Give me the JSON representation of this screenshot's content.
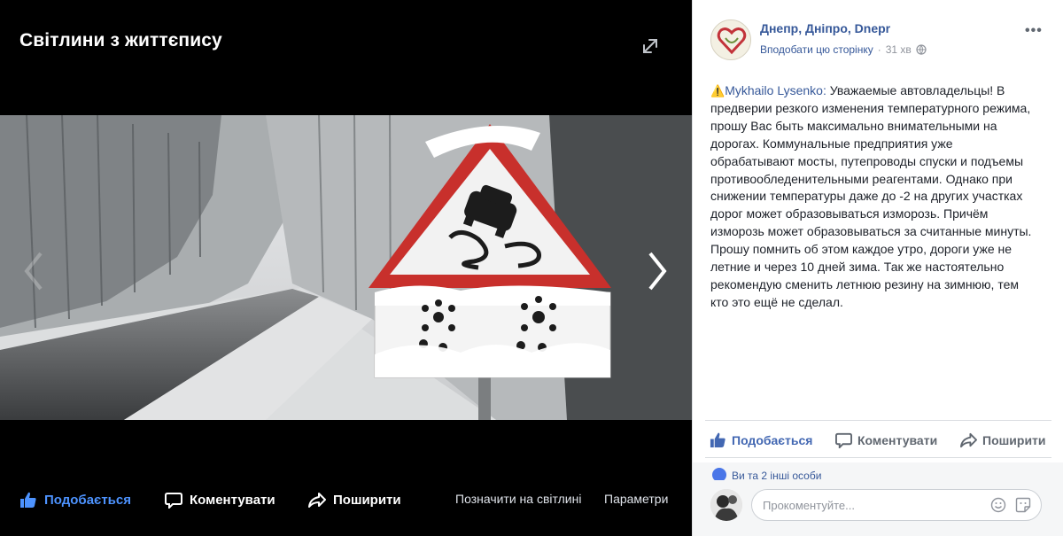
{
  "viewer": {
    "title": "Світлини з життєпису",
    "actions": {
      "like": "Подобається",
      "comment": "Коментувати",
      "share": "Поширити",
      "tag": "Позначити на світлині",
      "options": "Параметри"
    },
    "accent_color": "#4d93ff"
  },
  "post": {
    "page_name": "Днепр, Дніпро, Dnepr",
    "like_page": "Вподобати цю сторінку",
    "separator": "·",
    "time": "31 хв",
    "menu": "•••",
    "author": "Mykhailo Lysenko:",
    "body": " Уважаемые автовладельцы! В предверии резкого изменения температурного режима, прошу Вас быть максимально внимательными на дорогах. Коммунальные предприятия уже обрабатывают мосты, путепроводы спуски и подъемы противообледенительными реагентами. Однако при снижении температуры даже до -2 на других участках дорог может образовываться изморозь. Причём изморозь может образовываться за считанные минуты. Прошу помнить об этом каждое утро, дороги уже не летние и через 10 дней зима. Так же настоятельно рекомендую сменить летнюю резину на зимнюю, тем кто это ещё не сделал.",
    "warning_icon": "⚠️",
    "actions": {
      "like": "Подобається",
      "comment": "Коментувати",
      "share": "Поширити"
    },
    "reactions_text": "Ви та 2 інші особи",
    "comment_placeholder": "Прокоментуйте...",
    "link_color": "#365899"
  }
}
